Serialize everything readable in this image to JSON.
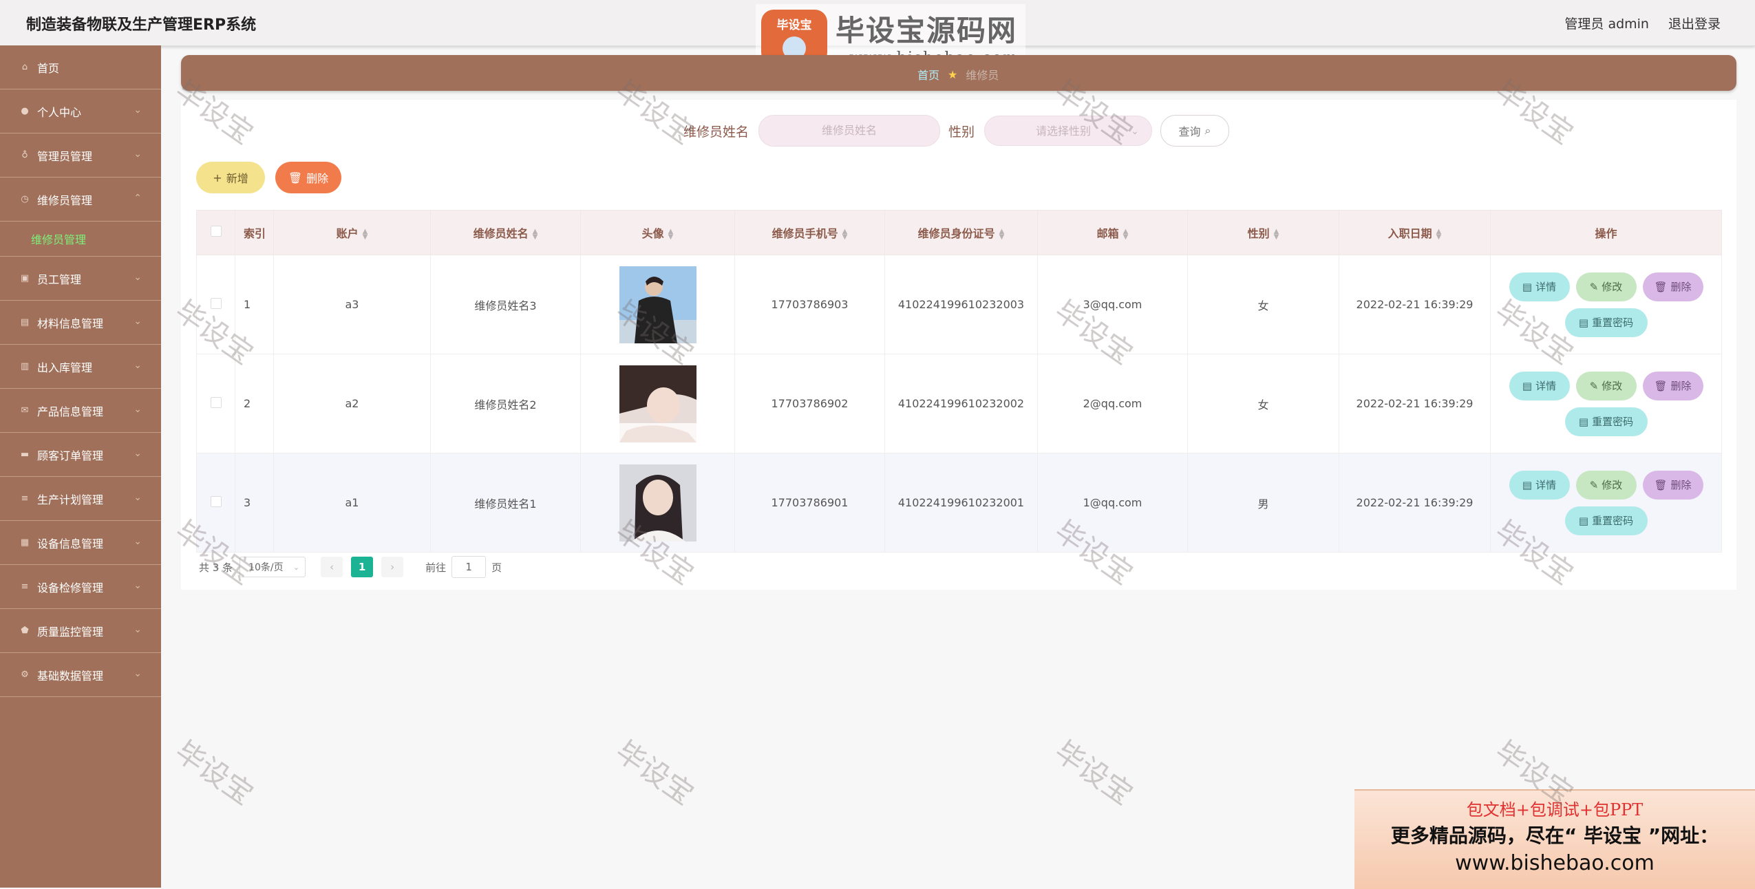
{
  "app": {
    "title": "制造装备物联及生产管理ERP系统"
  },
  "header": {
    "user_label": "管理员 admin",
    "logout": "退出登录"
  },
  "watermark_logo": {
    "badge": "毕设宝",
    "name": "毕设宝源码网",
    "url": "www.bishebao.com"
  },
  "sidebar": {
    "items": [
      {
        "label": "首页",
        "icon": "home-icon"
      },
      {
        "label": "个人中心",
        "icon": "user-icon"
      },
      {
        "label": "管理员管理",
        "icon": "mic-icon"
      },
      {
        "label": "维修员管理",
        "icon": "clock-icon",
        "expanded": true
      },
      {
        "label": "员工管理",
        "icon": "bag-icon"
      },
      {
        "label": "材料信息管理",
        "icon": "box-icon"
      },
      {
        "label": "出入库管理",
        "icon": "bar-chart-icon"
      },
      {
        "label": "产品信息管理",
        "icon": "mail-icon"
      },
      {
        "label": "顾客订单管理",
        "icon": "chat-icon"
      },
      {
        "label": "生产计划管理",
        "icon": "list-icon"
      },
      {
        "label": "设备信息管理",
        "icon": "grid-icon"
      },
      {
        "label": "设备检修管理",
        "icon": "list-icon"
      },
      {
        "label": "质量监控管理",
        "icon": "shield-icon"
      },
      {
        "label": "基础数据管理",
        "icon": "gear-icon"
      }
    ],
    "sub_item": "维修员管理"
  },
  "breadcrumb": {
    "home": "首页",
    "current": "维修员"
  },
  "search": {
    "name_label": "维修员姓名",
    "name_placeholder": "维修员姓名",
    "gender_label": "性别",
    "gender_placeholder": "请选择性别",
    "query_button": "查询"
  },
  "toolbar": {
    "add": "新增",
    "delete": "删除"
  },
  "table": {
    "headers": [
      "索引",
      "账户",
      "维修员姓名",
      "头像",
      "维修员手机号",
      "维修员身份证号",
      "邮箱",
      "性别",
      "入职日期",
      "操作"
    ],
    "rows": [
      {
        "index": "1",
        "account": "a3",
        "name": "维修员姓名3",
        "phone": "17703786903",
        "id_number": "410224199610232003",
        "email": "3@qq.com",
        "gender": "女",
        "date": "2022-02-21 16:39:29"
      },
      {
        "index": "2",
        "account": "a2",
        "name": "维修员姓名2",
        "phone": "17703786902",
        "id_number": "410224199610232002",
        "email": "2@qq.com",
        "gender": "女",
        "date": "2022-02-21 16:39:29"
      },
      {
        "index": "3",
        "account": "a1",
        "name": "维修员姓名1",
        "phone": "17703786901",
        "id_number": "410224199610232001",
        "email": "1@qq.com",
        "gender": "男",
        "date": "2022-02-21 16:39:29"
      }
    ],
    "actions": {
      "detail": "详情",
      "edit": "修改",
      "delete": "删除",
      "reset": "重置密码"
    }
  },
  "pagination": {
    "total": "共 3 条",
    "page_size": "10条/页",
    "current_page": "1",
    "goto_prefix": "前往",
    "goto_value": "1",
    "goto_suffix": "页"
  },
  "promo": {
    "line1": "包文档+包调试+包PPT",
    "line2": "更多精品源码，尽在“ 毕设宝 ”网址：",
    "line3": "www.bishebao.com"
  },
  "watermark_text": "毕设宝",
  "colors": {
    "sidebar": "#a0705a",
    "accent_green": "#7ff07a",
    "page_active": "#1bb394",
    "delete_button": "#f27b4b",
    "add_button": "#f4e28d"
  }
}
